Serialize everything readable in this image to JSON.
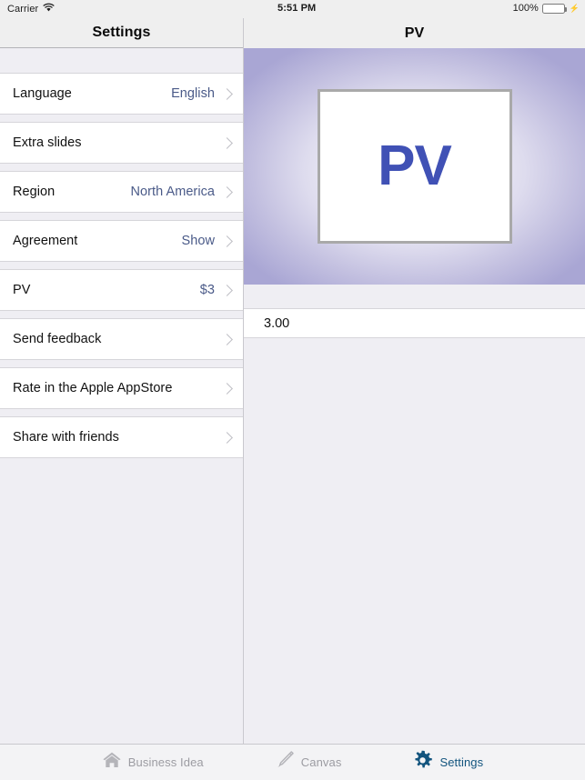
{
  "status_bar": {
    "carrier": "Carrier",
    "wifi_icon": "wifi-icon",
    "time": "5:51 PM",
    "battery_percent": "100%",
    "battery_icon": "battery-full-icon",
    "charging_icon": "lightning-bolt-icon",
    "battery_color": "#4cd964"
  },
  "left_panel": {
    "title": "Settings",
    "rows": [
      {
        "label": "Language",
        "detail": "English",
        "chevron": "chevron-right-icon"
      },
      {
        "label": "Extra slides",
        "detail": "",
        "chevron": "chevron-right-icon"
      },
      {
        "label": "Region",
        "detail": "North America",
        "chevron": "chevron-right-icon"
      },
      {
        "label": "Agreement",
        "detail": "Show",
        "chevron": "chevron-right-icon"
      },
      {
        "label": "PV",
        "detail": "$3",
        "chevron": "chevron-right-icon"
      },
      {
        "label": "Send feedback",
        "detail": "",
        "chevron": "chevron-right-icon"
      },
      {
        "label": "Rate in the Apple AppStore",
        "detail": "",
        "chevron": "chevron-right-icon"
      },
      {
        "label": "Share with friends",
        "detail": "",
        "chevron": "chevron-right-icon"
      }
    ]
  },
  "right_panel": {
    "title": "PV",
    "hero": {
      "logo_text": "PV",
      "logo_color": "#4051b5",
      "card_border_color": "#a9a9a9",
      "background_edge_color": "#a9a6d4",
      "background_center_color": "#fbfbfd"
    },
    "value_row": {
      "value": "3.00"
    }
  },
  "tab_bar": {
    "tabs": [
      {
        "label": "Business Idea",
        "icon": "home-icon",
        "active": false
      },
      {
        "label": "Canvas",
        "icon": "pencil-icon",
        "active": false
      },
      {
        "label": "Settings",
        "icon": "gear-icon",
        "active": true
      }
    ],
    "active_color": "#12547e",
    "inactive_color": "#9c9ca2"
  }
}
